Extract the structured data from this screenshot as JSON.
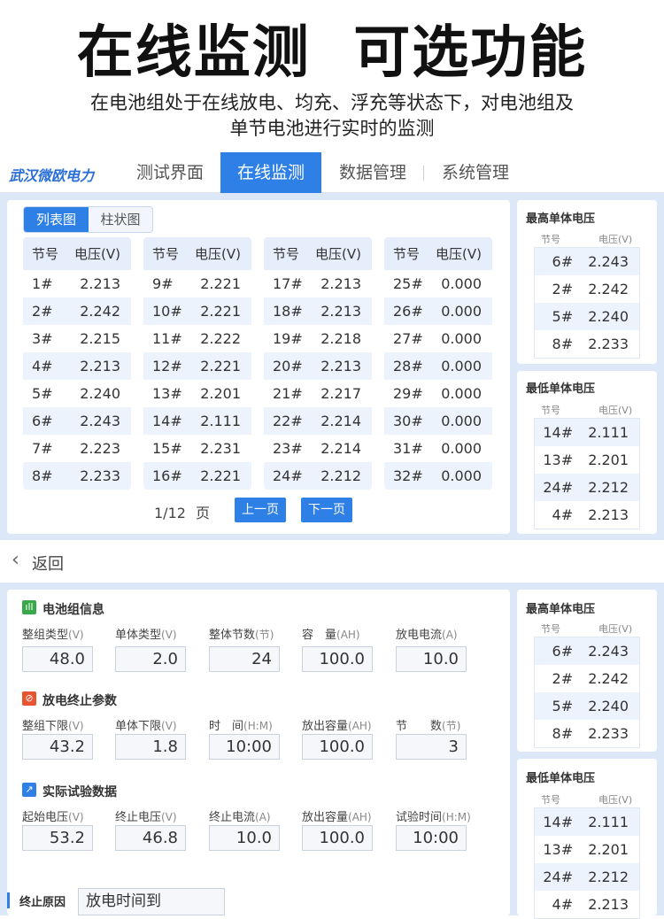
{
  "hero": {
    "title": "在线监测  可选功能",
    "subtitle_line1": "在电池组处于在线放电、均充、浮充等状态下，对电池组及",
    "subtitle_line2": "单节电池进行实时的监测"
  },
  "nav": {
    "logo": "武汉微欧电力",
    "tabs": [
      "测试界面",
      "在线监测",
      "数据管理",
      "系统管理"
    ],
    "active_tab": "在线监测"
  },
  "view_toggle": {
    "list": "列表图",
    "bar": "柱状图",
    "active": "列表图"
  },
  "voltage_table": {
    "col_no": "节号",
    "col_voltage": "电压(V)",
    "columns": [
      [
        [
          "1#",
          "2.213"
        ],
        [
          "2#",
          "2.242"
        ],
        [
          "3#",
          "2.215"
        ],
        [
          "4#",
          "2.213"
        ],
        [
          "5#",
          "2.240"
        ],
        [
          "6#",
          "2.243"
        ],
        [
          "7#",
          "2.223"
        ],
        [
          "8#",
          "2.233"
        ]
      ],
      [
        [
          "9#",
          "2.221"
        ],
        [
          "10#",
          "2.221"
        ],
        [
          "11#",
          "2.222"
        ],
        [
          "12#",
          "2.221"
        ],
        [
          "13#",
          "2.201"
        ],
        [
          "14#",
          "2.111"
        ],
        [
          "15#",
          "2.231"
        ],
        [
          "16#",
          "2.221"
        ]
      ],
      [
        [
          "17#",
          "2.213"
        ],
        [
          "18#",
          "2.213"
        ],
        [
          "19#",
          "2.218"
        ],
        [
          "20#",
          "2.213"
        ],
        [
          "21#",
          "2.217"
        ],
        [
          "22#",
          "2.214"
        ],
        [
          "23#",
          "2.214"
        ],
        [
          "24#",
          "2.212"
        ]
      ],
      [
        [
          "25#",
          "0.000"
        ],
        [
          "26#",
          "0.000"
        ],
        [
          "27#",
          "0.000"
        ],
        [
          "28#",
          "0.000"
        ],
        [
          "29#",
          "0.000"
        ],
        [
          "30#",
          "0.000"
        ],
        [
          "31#",
          "0.000"
        ],
        [
          "32#",
          "0.000"
        ]
      ]
    ]
  },
  "pagination": {
    "info": "1/12 页",
    "prev": "上一页",
    "next": "下一页"
  },
  "side": {
    "col_no": "节号",
    "col_voltage": "电压(V)",
    "highest_title": "最高单体电压",
    "highest": [
      [
        "6#",
        "2.243"
      ],
      [
        "2#",
        "2.242"
      ],
      [
        "5#",
        "2.240"
      ],
      [
        "8#",
        "2.233"
      ]
    ],
    "lowest_title": "最低单体电压",
    "lowest": [
      [
        "14#",
        "2.111"
      ],
      [
        "13#",
        "2.201"
      ],
      [
        "24#",
        "2.212"
      ],
      [
        "4#",
        "2.213"
      ]
    ]
  },
  "back": {
    "label": "返回"
  },
  "battery_info": {
    "title": "电池组信息",
    "fields": [
      {
        "label": "整组类型",
        "unit": "(V)",
        "value": "48.0"
      },
      {
        "label": "单体类型",
        "unit": "(V)",
        "value": "2.0"
      },
      {
        "label": "整体节数",
        "unit": "(节)",
        "value": "24"
      },
      {
        "label": "容　量",
        "unit": "(AH)",
        "value": "100.0"
      },
      {
        "label": "放电电流",
        "unit": "(A)",
        "value": "10.0"
      }
    ]
  },
  "stop_params": {
    "title": "放电终止参数",
    "fields": [
      {
        "label": "整组下限",
        "unit": "(V)",
        "value": "43.2"
      },
      {
        "label": "单体下限",
        "unit": "(V)",
        "value": "1.8"
      },
      {
        "label": "时　间",
        "unit": "(H:M)",
        "value": "10:00"
      },
      {
        "label": "放出容量",
        "unit": "(AH)",
        "value": "100.0"
      },
      {
        "label": "节　　数",
        "unit": "(节)",
        "value": "3"
      }
    ]
  },
  "actual_data": {
    "title": "实际试验数据",
    "fields": [
      {
        "label": "起始电压",
        "unit": "(V)",
        "value": "53.2"
      },
      {
        "label": "终止电压",
        "unit": "(V)",
        "value": "46.8"
      },
      {
        "label": "终止电流",
        "unit": "(A)",
        "value": "10.0"
      },
      {
        "label": "放出容量",
        "unit": "(AH)",
        "value": "100.0"
      },
      {
        "label": "试验时间",
        "unit": "(H:M)",
        "value": "10:00"
      }
    ]
  },
  "stop_reason": {
    "label": "终止原因",
    "value": "放电时间到"
  },
  "colors": {
    "accent": "#2f80e6",
    "panel_bg": "#dce8f8",
    "row_alt": "#edf3fc",
    "stop_icon": "#e8542f",
    "info_icon": "#3aa84a"
  }
}
